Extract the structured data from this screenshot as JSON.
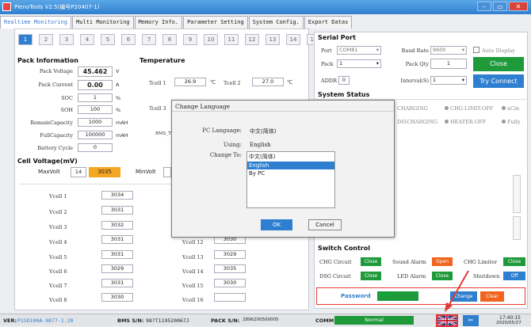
{
  "window": {
    "title": "PlenoTools V2.5(编号P20407-1)"
  },
  "tabs": [
    {
      "label": "Realtime Monitoring"
    },
    {
      "label": "Multi Monitoring"
    },
    {
      "label": "Memory Info."
    },
    {
      "label": "Parameter Setting"
    },
    {
      "label": "System Config."
    },
    {
      "label": "Export Datas"
    }
  ],
  "pack_tabs": [
    "1",
    "2",
    "3",
    "4",
    "5",
    "6",
    "7",
    "8",
    "9",
    "10",
    "11",
    "12",
    "13",
    "14",
    "15"
  ],
  "pack_info": {
    "title": "Pack Information",
    "voltage": {
      "label": "Pack Voltage",
      "value": "45.462",
      "unit": "V"
    },
    "current": {
      "label": "Pack Current",
      "value": "0.00",
      "unit": "A"
    },
    "soc": {
      "label": "SOC",
      "value": "1",
      "unit": "%"
    },
    "soh": {
      "label": "SOH",
      "value": "100",
      "unit": "%"
    },
    "remain": {
      "label": "RemainCapacity",
      "value": "1000",
      "unit": "mAH"
    },
    "full": {
      "label": "FullCapacity",
      "value": "100000",
      "unit": "mAH"
    },
    "cycle": {
      "label": "Battery Cycle",
      "value": "0"
    }
  },
  "temperature": {
    "title": "Temperature",
    "tcell1": {
      "label": "Tcell 1",
      "value": "26.9",
      "unit": "℃"
    },
    "tcell2": {
      "label": "Tcell 2",
      "value": "27.0",
      "unit": "℃"
    },
    "tcell3_label": "Tcell 3",
    "bms_label": "BMS_T"
  },
  "cell_voltage": {
    "title": "Cell Voltage(mV)",
    "maxvolt_label": "MaxVolt",
    "max_index": "14",
    "max_value": "3035",
    "minvolt_label": "MinVolt",
    "left": [
      {
        "label": "Vcell 1",
        "value": "3034"
      },
      {
        "label": "Vcell 2",
        "value": "3031"
      },
      {
        "label": "Vcell 3",
        "value": "3032"
      },
      {
        "label": "Vcell 4",
        "value": "3031"
      },
      {
        "label": "Vcell 5",
        "value": "3031"
      },
      {
        "label": "Vcell 6",
        "value": "3029"
      },
      {
        "label": "Vcell 7",
        "value": "3031"
      },
      {
        "label": "Vcell 8",
        "value": "3030"
      }
    ],
    "right": [
      {
        "label": "Vcell 12",
        "value": "3030"
      },
      {
        "label": "Vcell 13",
        "value": "3029"
      },
      {
        "label": "Vcell 14",
        "value": "3035"
      },
      {
        "label": "Vcell 15",
        "value": "3030"
      },
      {
        "label": "Vcell 16",
        "value": ""
      }
    ]
  },
  "serial": {
    "title": "Serial Port",
    "port_label": "Port",
    "port_value": "COM81",
    "baud_label": "Baud Rate",
    "baud_value": "9600",
    "auto_display": "Auto Display",
    "pack_label": "Pack",
    "pack_value": "1",
    "packqty_label": "Pack Qty",
    "packqty_value": "1",
    "close": "Close",
    "addr_label": "ADDR",
    "addr_value": "0",
    "interval_label": "Interval(S)",
    "interval_value": "1",
    "try": "Try Connect"
  },
  "system_status": {
    "title": "System Status",
    "row1": [
      "CHARGING",
      "CHG-LIMIT-OFF",
      "aCin"
    ],
    "row2": [
      "DISCHARGING",
      "HEATER-OFF",
      "Fully"
    ]
  },
  "switch": {
    "title": "Switch Control",
    "chg_label": "CHG Circuit",
    "chg_btn": "Close",
    "sound_label": "Sound Alarm",
    "sound_btn": "Open",
    "limiter_label": "CHG Limiter",
    "limiter_btn": "Close",
    "dsg_label": "DSG Circuit",
    "dsg_btn": "Close",
    "led_label": "LED Alarm",
    "led_btn": "Close",
    "shutdown_label": "Shutdown",
    "shutdown_btn": "Off"
  },
  "password": {
    "label": "Password",
    "value": "******",
    "change": "Change",
    "clear": "Clear"
  },
  "dialog": {
    "title": "Change Language",
    "pc_label": "PC Language:",
    "pc_value": "中文(简体)",
    "using_label": "Using:",
    "using_value": "English",
    "change_label": "Change To:",
    "options": [
      "中文(简体)",
      "English",
      "By PC"
    ],
    "ok": "OK",
    "cancel": "Cancel"
  },
  "statusbar": {
    "ver_label": "VER:",
    "ver_value": "P15D100A-9877-1.20",
    "bms_label": "BMS S/N:",
    "bms_value": "98?T119520067J",
    "pack_label": "PACK S/N:",
    "pack_value": "2896200500005",
    "comm_label": "COMM:",
    "comm_value": "Normal",
    "time": "17:40:15",
    "date": "2020/05/27"
  },
  "colors": {
    "accent": "#2f7fd0",
    "green": "#1e9a3b",
    "orange": "#f0641e",
    "highlight": "#e53935"
  }
}
